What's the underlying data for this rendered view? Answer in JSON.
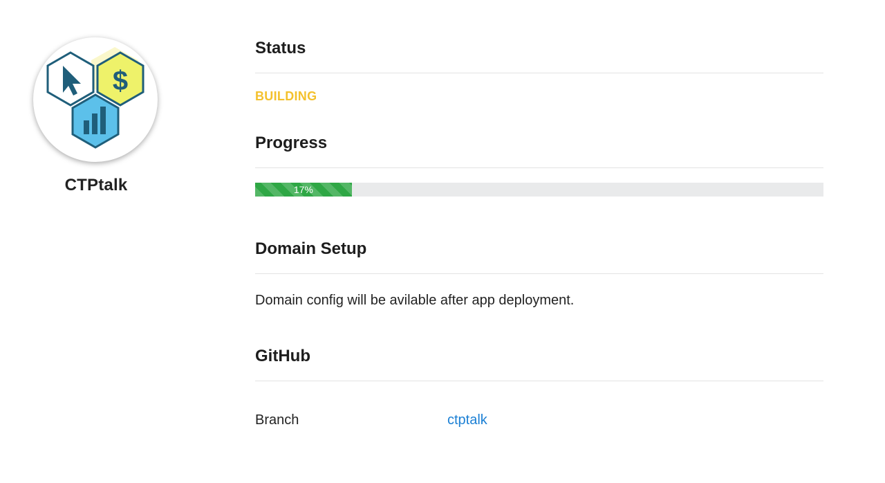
{
  "app": {
    "name": "CTPtalk",
    "logo_icon": "ctptalk-hexagon-logo-icon",
    "logo_glyphs": {
      "cursor": "cursor-icon",
      "dollar": "$",
      "chart": "bar-chart-icon"
    }
  },
  "status": {
    "title": "Status",
    "value": "BUILDING",
    "color": "#f4c12d"
  },
  "progress": {
    "title": "Progress",
    "percent": 17,
    "label": "17%",
    "bar_color": "#2fa745"
  },
  "domain": {
    "title": "Domain Setup",
    "message": "Domain config will be avilable after app deployment."
  },
  "github": {
    "title": "GitHub",
    "branch_label": "Branch",
    "branch_value": "ctptalk",
    "link_color": "#1a7fd4"
  }
}
